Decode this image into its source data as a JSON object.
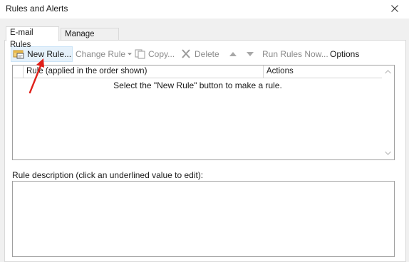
{
  "window": {
    "title": "Rules and Alerts"
  },
  "tabs": [
    {
      "label": "E-mail Rules",
      "active": true
    },
    {
      "label": "Manage Alerts",
      "active": false
    }
  ],
  "toolbar": {
    "new_rule": "New Rule...",
    "change_rule": "Change Rule",
    "copy": "Copy...",
    "delete": "Delete",
    "run_rules_now": "Run Rules Now...",
    "options": "Options"
  },
  "rules_list": {
    "columns": [
      "Rule (applied in the order shown)",
      "Actions"
    ],
    "empty_message": "Select the \"New Rule\" button to make a rule."
  },
  "description": {
    "label": "Rule description (click an underlined value to edit):"
  },
  "colors": {
    "annotation_arrow": "#e0201a",
    "hover_bg": "#e5f1fb"
  }
}
